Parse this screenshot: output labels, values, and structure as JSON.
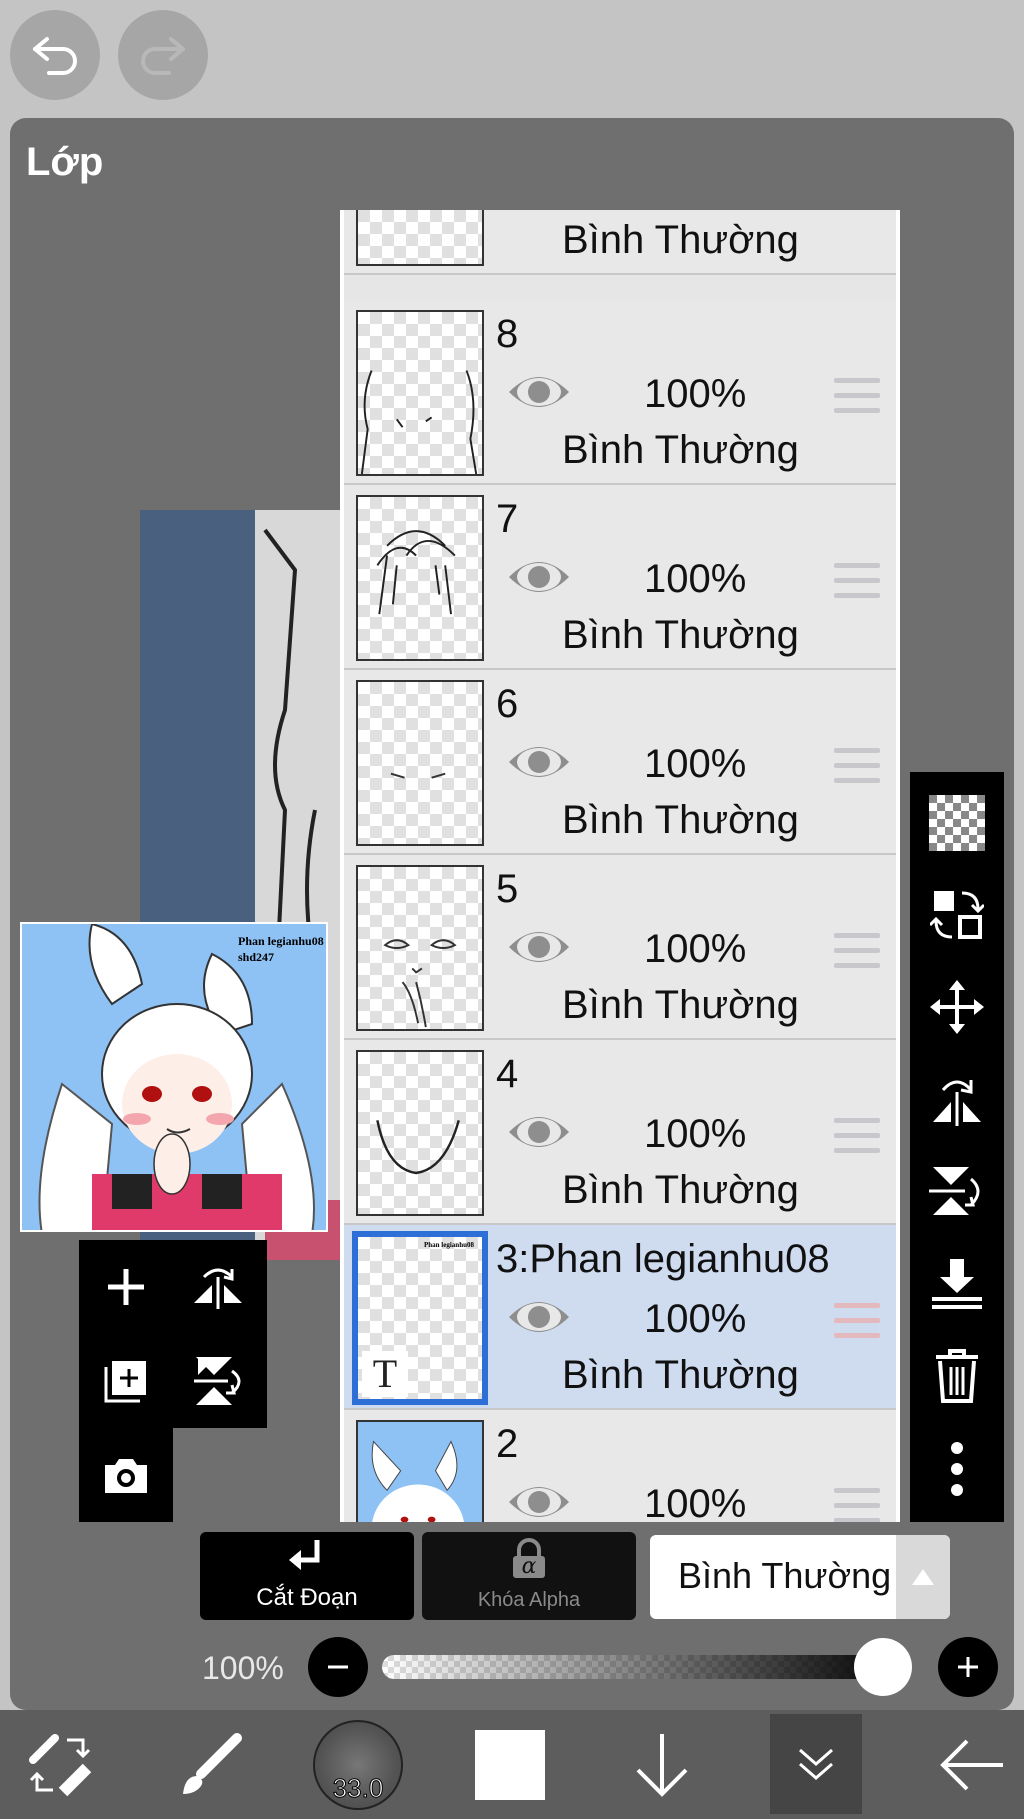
{
  "panel": {
    "title": "Lớp"
  },
  "thumbnail": {
    "watermark_line1": "Phan legianhu08",
    "watermark_line2": "shd247"
  },
  "layers": [
    {
      "number": "",
      "opacity": "100%",
      "blend": "Bình Thường",
      "partial": "top"
    },
    {
      "number": "8",
      "opacity": "100%",
      "blend": "Bình Thường"
    },
    {
      "number": "7",
      "opacity": "100%",
      "blend": "Bình Thường"
    },
    {
      "number": "6",
      "opacity": "100%",
      "blend": "Bình Thường"
    },
    {
      "number": "5",
      "opacity": "100%",
      "blend": "Bình Thường"
    },
    {
      "number": "4",
      "opacity": "100%",
      "blend": "Bình Thường"
    },
    {
      "number": "3:Phan legianhu08",
      "opacity": "100%",
      "blend": "Bình Thường",
      "selected": true,
      "text_layer_glyph": "T"
    },
    {
      "number": "2",
      "opacity": "100%",
      "blend": "",
      "partial": "bottom"
    }
  ],
  "actions": {
    "clip_label": "Cắt Đoạn",
    "alpha_lock_label": "Khóa Alpha",
    "alpha_glyph": "α",
    "blend_mode": "Bình Thường"
  },
  "opacity": {
    "label": "100%",
    "value": 1.0
  },
  "brush": {
    "size_label": "33.0"
  },
  "colors": {
    "selection": "#2d6fd6",
    "panel": "#6f6f6f",
    "background": "#c4c4c4"
  }
}
